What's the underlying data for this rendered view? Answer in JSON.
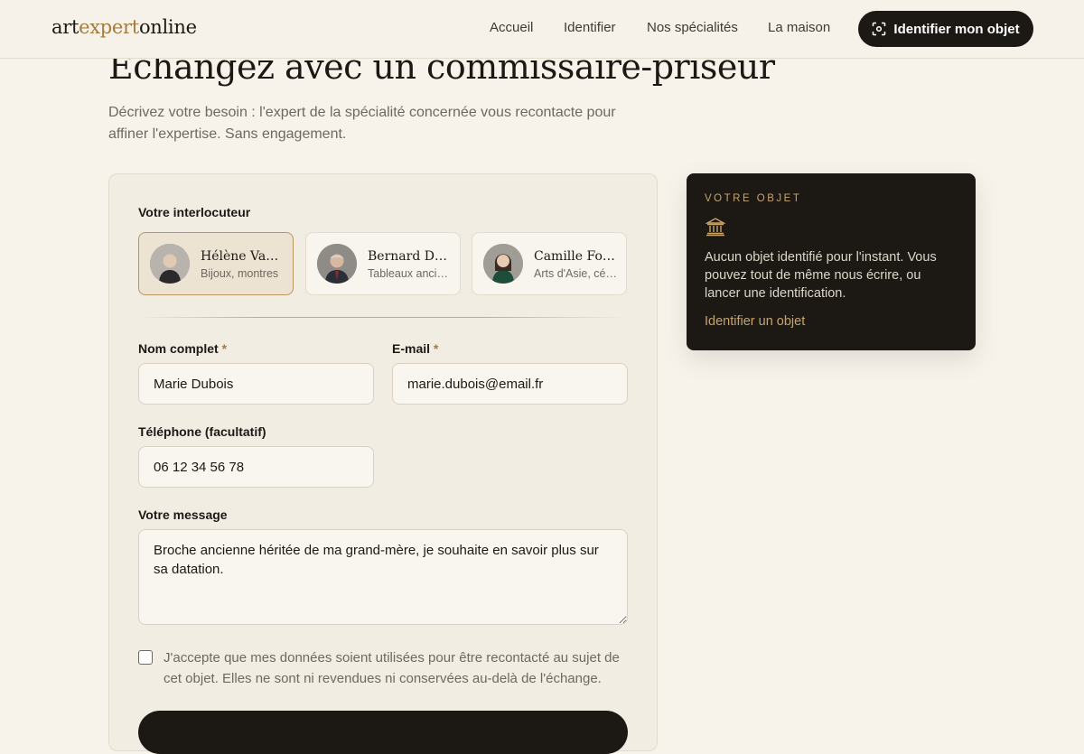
{
  "header": {
    "logo": {
      "part1": "art",
      "part2": "expert",
      "part3": "online"
    },
    "nav": [
      "Accueil",
      "Identifier",
      "Nos spécialités",
      "La maison"
    ],
    "cta_label": "Identifier mon objet",
    "cta_icon": "scan-icon"
  },
  "page": {
    "title": "Échangez avec un commissaire-priseur",
    "subtitle": "Décrivez votre besoin : l'expert de la spécialité concernée vous recontacte pour affiner l'expertise. Sans engagement."
  },
  "form": {
    "interlocutor_label": "Votre interlocuteur",
    "experts": [
      {
        "name": "Hélène Vassal",
        "specialty": "Bijoux, montres",
        "selected": true
      },
      {
        "name": "Bernard Delorme",
        "specialty": "Tableaux anciens",
        "selected": false
      },
      {
        "name": "Camille Fontaine",
        "specialty": "Arts d'Asie, céramiques",
        "selected": false
      }
    ],
    "name_label": "Nom complet",
    "name_value": "Marie Dubois",
    "email_label": "E-mail",
    "email_value": "marie.dubois@email.fr",
    "required_mark": "*",
    "phone_label": "Téléphone (facultatif)",
    "phone_value": "06 12 34 56 78",
    "message_label": "Votre message",
    "message_value": "Broche ancienne héritée de ma grand-mère, je souhaite en savoir plus sur sa datation.",
    "consent_text": "J'accepte que mes données soient utilisées pour être recontacté au sujet de cet objet. Elles ne sont ni revendues ni conservées au-delà de l'échange.",
    "consent_checked": false
  },
  "object_card": {
    "eyebrow": "VOTRE OBJET",
    "icon": "museum-icon",
    "text": "Aucun objet identifié pour l'instant. Vous pouvez tout de même nous écrire, ou lancer une identification.",
    "link": "Identifier un objet"
  },
  "colors": {
    "background": "#f7f3eb",
    "accent_gold": "#a37c3e",
    "dark": "#1c1915",
    "muted_text": "#6f685e"
  }
}
